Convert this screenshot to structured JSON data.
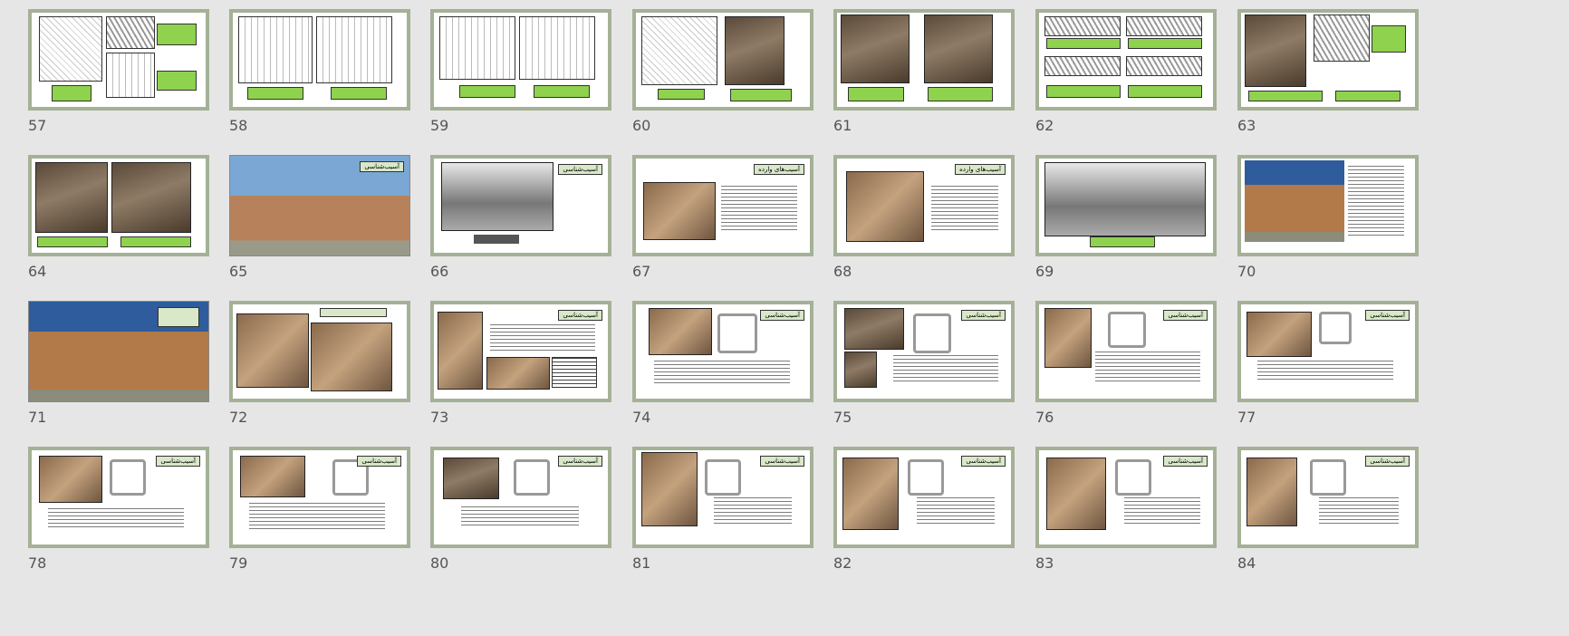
{
  "slides": [
    {
      "n": "57"
    },
    {
      "n": "58"
    },
    {
      "n": "59"
    },
    {
      "n": "60"
    },
    {
      "n": "61"
    },
    {
      "n": "62"
    },
    {
      "n": "63"
    },
    {
      "n": "64"
    },
    {
      "n": "65",
      "tag": "آسیب‌شناسی"
    },
    {
      "n": "66",
      "tag": "آسیب‌شناسی"
    },
    {
      "n": "67",
      "tag": "آسیب‌های وارده"
    },
    {
      "n": "68",
      "tag": "آسیب‌های وارده"
    },
    {
      "n": "69"
    },
    {
      "n": "70"
    },
    {
      "n": "71"
    },
    {
      "n": "72"
    },
    {
      "n": "73",
      "tag": "آسیب‌شناسی"
    },
    {
      "n": "74",
      "tag": "آسیب‌شناسی"
    },
    {
      "n": "75",
      "tag": "آسیب‌شناسی"
    },
    {
      "n": "76",
      "tag": "آسیب‌شناسی"
    },
    {
      "n": "77",
      "tag": "آسیب‌شناسی"
    },
    {
      "n": "78",
      "tag": "آسیب‌شناسی"
    },
    {
      "n": "79",
      "tag": "آسیب‌شناسی"
    },
    {
      "n": "80",
      "tag": "آسیب‌شناسی"
    },
    {
      "n": "81",
      "tag": "آسیب‌شناسی"
    },
    {
      "n": "82",
      "tag": "آسیب‌شناسی"
    },
    {
      "n": "83",
      "tag": "آسیب‌شناسی"
    },
    {
      "n": "84",
      "tag": "آسیب‌شناسی"
    }
  ]
}
